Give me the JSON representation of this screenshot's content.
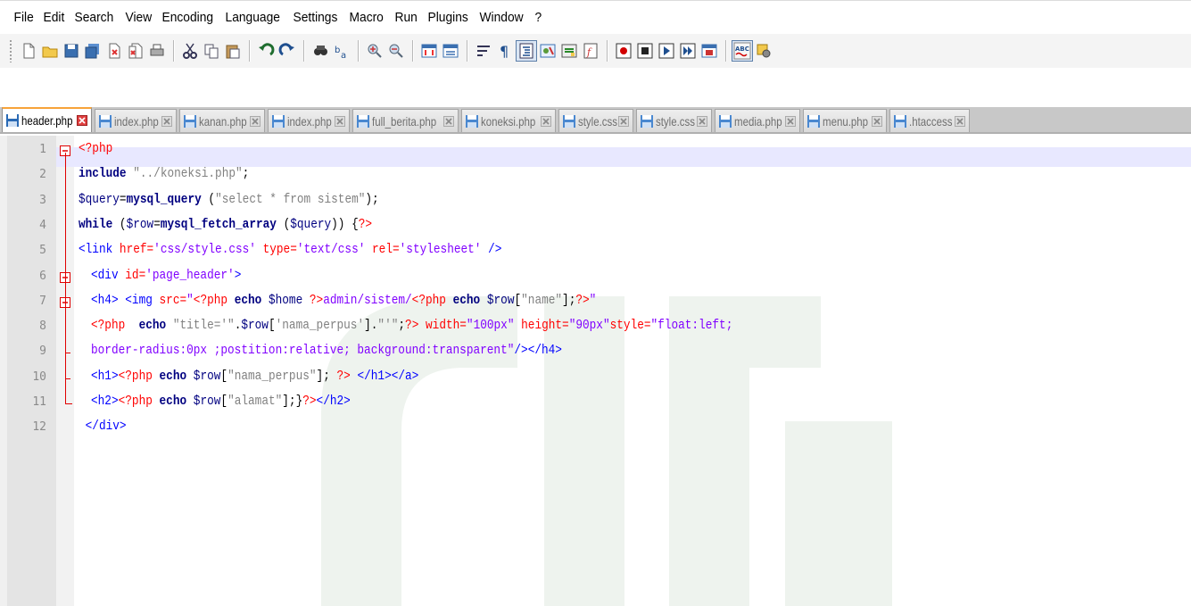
{
  "menu": [
    "File",
    "Edit",
    "Search",
    "View",
    "Encoding",
    "Language",
    "Settings",
    "Macro",
    "Run",
    "Plugins",
    "Window",
    "?"
  ],
  "toolbar": {
    "groups": [
      [
        "new-file-icon",
        "open-file-icon",
        "save-icon",
        "save-all-icon",
        "close-icon",
        "close-all-icon",
        "print-icon"
      ],
      [
        "cut-icon",
        "copy-icon",
        "paste-icon"
      ],
      [
        "undo-icon",
        "redo-icon"
      ],
      [
        "find-icon",
        "replace-icon"
      ],
      [
        "zoom-in-icon",
        "zoom-out-icon"
      ],
      [
        "sync-vertical-icon",
        "sync-horizontal-icon"
      ],
      [
        "word-wrap-icon",
        "show-all-characters-icon",
        "indent-guide-icon",
        "user-language-icon",
        "document-map-icon",
        "function-list-icon"
      ],
      [
        "record-macro-icon",
        "stop-recording-icon",
        "playback-macro-icon",
        "run-macro-multiple-icon",
        "save-macro-icon"
      ],
      [
        "spell-check-icon",
        "spell-check-settings-icon"
      ]
    ]
  },
  "tabs": [
    {
      "label": "header.php",
      "active": true
    },
    {
      "label": "index.php",
      "active": false
    },
    {
      "label": "kanan.php",
      "active": false
    },
    {
      "label": "index.php",
      "active": false
    },
    {
      "label": "full_berita.php",
      "active": false
    },
    {
      "label": "koneksi.php",
      "active": false
    },
    {
      "label": "style.css",
      "active": false
    },
    {
      "label": "style.css",
      "active": false
    },
    {
      "label": "media.php",
      "active": false
    },
    {
      "label": "menu.php",
      "active": false
    },
    {
      "label": ".htaccess",
      "active": false
    }
  ],
  "editor": {
    "lines": [
      {
        "n": "1",
        "indent": 0,
        "fold": "box",
        "tokens": [
          [
            "<?php",
            "#ff0000"
          ]
        ]
      },
      {
        "n": "2",
        "indent": 1,
        "fold": "line",
        "tokens": [
          [
            "include",
            "#000080b"
          ],
          [
            " ",
            "#000"
          ],
          [
            "\"../koneksi.php\"",
            "#808080"
          ],
          [
            ";",
            "#000"
          ]
        ]
      },
      {
        "n": "3",
        "indent": 1,
        "fold": "line",
        "tokens": [
          [
            "$query",
            "#000080"
          ],
          [
            "=",
            "#000"
          ],
          [
            "mysql_query",
            "#000080b"
          ],
          [
            " (",
            "#000"
          ],
          [
            "\"select * from sistem\"",
            "#808080"
          ],
          [
            ");",
            "#000"
          ]
        ]
      },
      {
        "n": "4",
        "indent": 1,
        "fold": "line",
        "tokens": [
          [
            "while",
            "#000080b"
          ],
          [
            " (",
            "#000"
          ],
          [
            "$row",
            "#000080"
          ],
          [
            "=",
            "#000"
          ],
          [
            "mysql_fetch_array",
            "#000080b"
          ],
          [
            " (",
            "#000"
          ],
          [
            "$query",
            "#000080"
          ],
          [
            ")) {",
            "#000"
          ],
          [
            "?>",
            "#ff0000"
          ]
        ]
      },
      {
        "n": "5",
        "indent": 1,
        "fold": "line",
        "tokens": [
          [
            "<link",
            "#0000ff"
          ],
          [
            " href=",
            "#ff0000"
          ],
          [
            "'css/style.css'",
            "#8000ff"
          ],
          [
            " type=",
            "#ff0000"
          ],
          [
            "'text/css'",
            "#8000ff"
          ],
          [
            " rel=",
            "#ff0000"
          ],
          [
            "'stylesheet'",
            "#8000ff"
          ],
          [
            " />",
            "#0000ff"
          ]
        ]
      },
      {
        "n": "6",
        "indent": 2,
        "fold": "box",
        "tokens": [
          [
            "<div",
            "#0000ff"
          ],
          [
            " id=",
            "#ff0000"
          ],
          [
            "'page_header'",
            "#8000ff"
          ],
          [
            ">",
            "#0000ff"
          ]
        ]
      },
      {
        "n": "7",
        "indent": 2,
        "fold": "box",
        "tokens": [
          [
            "<h4>",
            "#0000ff"
          ],
          [
            " <img",
            "#0000ff"
          ],
          [
            " src=",
            "#ff0000"
          ],
          [
            "\"",
            "#8000ff"
          ],
          [
            "<?php",
            "#ff0000"
          ],
          [
            " echo ",
            "#000080b"
          ],
          [
            "$home",
            "#000080"
          ],
          [
            " ?>",
            "#ff0000"
          ],
          [
            "admin/sistem/",
            "#8000ff"
          ],
          [
            "<?php",
            "#ff0000"
          ],
          [
            " echo ",
            "#000080b"
          ],
          [
            "$row",
            "#000080"
          ],
          [
            "[",
            "#000"
          ],
          [
            "\"name\"",
            "#808080"
          ],
          [
            "];",
            "#000"
          ],
          [
            "?>",
            "#ff0000"
          ],
          [
            "\"",
            "#8000ff"
          ]
        ]
      },
      {
        "n": "8",
        "indent": 2,
        "fold": "line",
        "tokens": [
          [
            "<?php",
            "#ff0000"
          ],
          [
            "  echo ",
            "#000080b"
          ],
          [
            "\"title='\"",
            "#808080"
          ],
          [
            ".",
            "#000"
          ],
          [
            "$row",
            "#000080"
          ],
          [
            "[",
            "#000"
          ],
          [
            "'nama_perpus'",
            "#808080"
          ],
          [
            "].",
            "#000"
          ],
          [
            "\"'\"",
            "#808080"
          ],
          [
            ";",
            "#000"
          ],
          [
            "?>",
            "#ff0000"
          ],
          [
            " width=",
            "#ff0000"
          ],
          [
            "\"100px\"",
            "#8000ff"
          ],
          [
            " height=",
            "#ff0000"
          ],
          [
            "\"90px\"",
            "#8000ff"
          ],
          [
            "style=",
            "#ff0000"
          ],
          [
            "\"float:left;",
            "#8000ff"
          ]
        ]
      },
      {
        "n": "9",
        "indent": 2,
        "fold": "tick",
        "tokens": [
          [
            "border-radius:0px ;postition:relative; background:transparent\"",
            "#8000ff"
          ],
          [
            "/>",
            "#0000ff"
          ],
          [
            "</h4>",
            "#0000ff"
          ]
        ]
      },
      {
        "n": "10",
        "indent": 2,
        "fold": "tick",
        "tokens": [
          [
            "<h1>",
            "#0000ff"
          ],
          [
            "<?php",
            "#ff0000"
          ],
          [
            " echo ",
            "#000080b"
          ],
          [
            "$row",
            "#000080"
          ],
          [
            "[",
            "#000"
          ],
          [
            "\"nama_perpus\"",
            "#808080"
          ],
          [
            "]; ",
            "#000"
          ],
          [
            "?>",
            "#ff0000"
          ],
          [
            " </h1>",
            "#0000ff"
          ],
          [
            "</a>",
            "#0000ff"
          ]
        ]
      },
      {
        "n": "11",
        "indent": 2,
        "fold": "end",
        "tokens": [
          [
            "<h2>",
            "#0000ff"
          ],
          [
            "<?php",
            "#ff0000"
          ],
          [
            " echo ",
            "#000080b"
          ],
          [
            "$row",
            "#000080"
          ],
          [
            "[",
            "#000"
          ],
          [
            "\"alamat\"",
            "#808080"
          ],
          [
            "];}",
            "#000"
          ],
          [
            "?>",
            "#ff0000"
          ],
          [
            "</h2>",
            "#0000ff"
          ]
        ]
      },
      {
        "n": "12",
        "indent": 1,
        "fold": "none",
        "tokens": [
          [
            " </div>",
            "#0000ff"
          ]
        ]
      }
    ]
  },
  "colors": {
    "active_tab_accent": "#f7a33a",
    "fold_marker": "#e00000",
    "current_line": "#e8e8ff",
    "php_tag": "#ff0000",
    "html_tag": "#0000ff",
    "attr_value": "#8000ff",
    "string": "#808080",
    "keyword": "#000080"
  }
}
